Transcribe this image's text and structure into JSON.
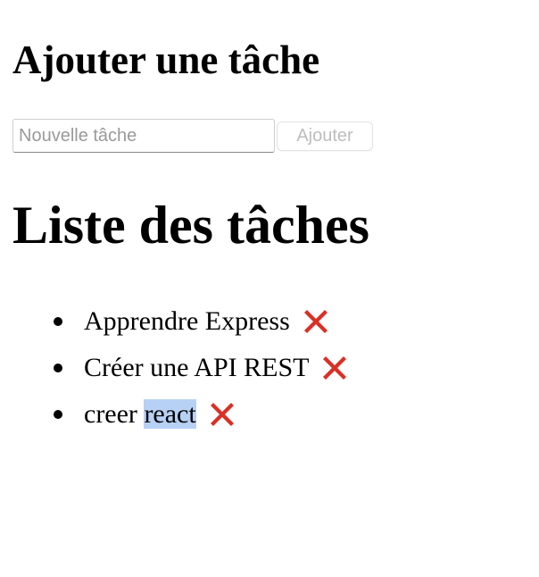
{
  "form": {
    "heading": "Ajouter une tâche",
    "input_placeholder": "Nouvelle tâche",
    "input_value": "",
    "add_button_label": "Ajouter"
  },
  "list": {
    "heading": "Liste des tâches",
    "items": [
      {
        "text": "Apprendre Express",
        "delete_icon": "cross-mark-icon"
      },
      {
        "text": "Créer une API REST",
        "delete_icon": "cross-mark-icon"
      },
      {
        "text_before_selection": "creer ",
        "selected_text": "react",
        "delete_icon": "cross-mark-icon"
      }
    ]
  },
  "colors": {
    "delete_icon": "#d93025",
    "selection_highlight": "#b7d1f5",
    "button_text_disabled": "#bdbdbd"
  }
}
